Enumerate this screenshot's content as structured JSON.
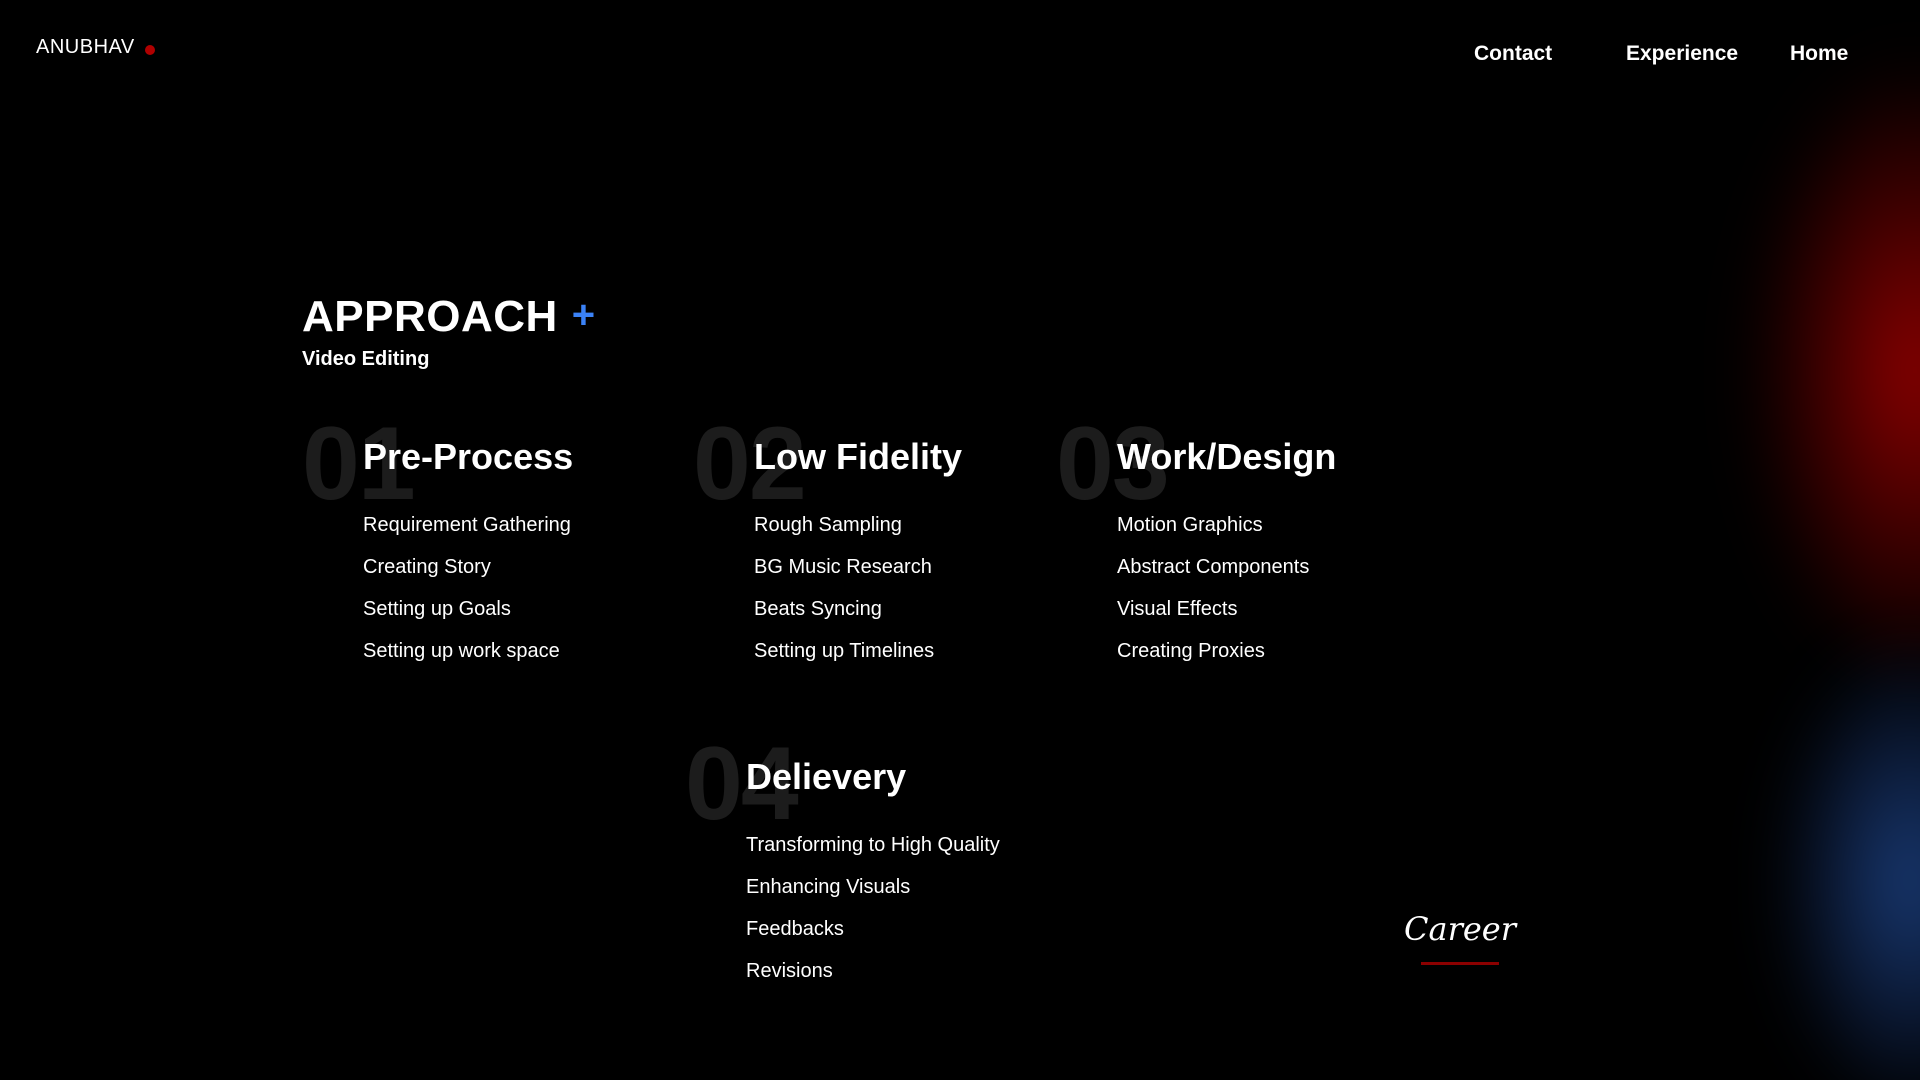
{
  "header": {
    "logo_text": "ANUBHAV",
    "logo_dot_color": "#b00000",
    "nav": {
      "contact": "Contact",
      "experience": "Experience",
      "home": "Home"
    }
  },
  "approach": {
    "title": "APPROACH",
    "plus_symbol": "+",
    "accent_color": "#3b82f6",
    "subtitle": "Video Editing"
  },
  "steps": [
    {
      "number": "01",
      "title": "Pre-Process",
      "items": [
        "Requirement Gathering",
        "Creating Story",
        "Setting up Goals",
        "Setting up work space"
      ]
    },
    {
      "number": "02",
      "title": "Low Fidelity",
      "items": [
        "Rough Sampling",
        "BG Music Research",
        "Beats Syncing",
        "Setting up Timelines"
      ]
    },
    {
      "number": "03",
      "title": "Work/Design",
      "items": [
        "Motion Graphics",
        "Abstract Components",
        "Visual Effects",
        "Creating Proxies"
      ]
    },
    {
      "number": "04",
      "title": "Delievery",
      "items": [
        "Transforming to High Quality",
        "Enhancing Visuals",
        "Feedbacks",
        "Revisions"
      ]
    }
  ],
  "career": {
    "label": "Career",
    "underline_color": "#8b0000"
  },
  "colors": {
    "background": "#000000",
    "glow_red": "#960000",
    "glow_blue": "#1e468c"
  }
}
